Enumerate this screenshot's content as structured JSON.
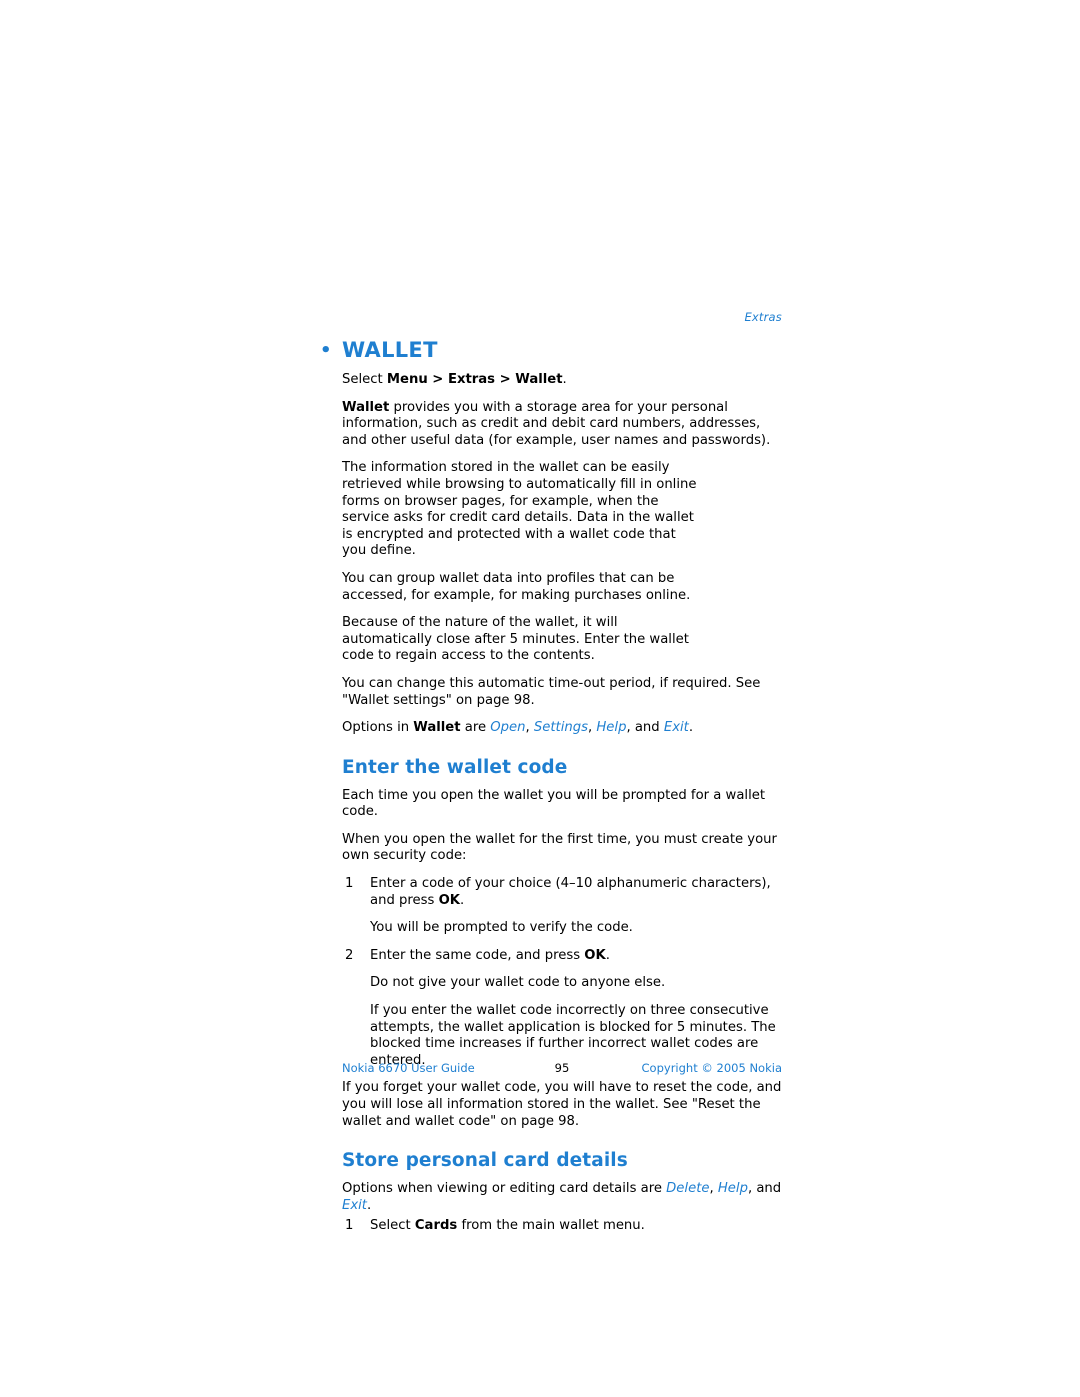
{
  "running_head": "Extras",
  "section": {
    "title": "WALLET",
    "select_path_prefix": "Select ",
    "select_path_bold": "Menu > Extras > Wallet",
    "select_path_suffix": ".",
    "para_wallet_lead_bold": "Wallet",
    "para_wallet_lead": " provides you with a storage area for your personal information, such as credit and debit card numbers, addresses, and other useful data (for example, user names and passwords).",
    "para_info_stored": "The information stored in the wallet can be easily retrieved while browsing to automatically fill in online forms on browser pages, for example, when the service asks for credit card details. Data in the wallet is encrypted and protected with a wallet code that you define.",
    "para_group": "You can group wallet data into profiles that can be accessed, for example, for making purchases online.",
    "para_nature": "Because of the nature of the wallet, it will automatically close after 5 minutes. Enter the wallet code to regain access to the contents.",
    "para_timeout": "You can change this automatic time-out period, if required. See \"Wallet settings\" on page 98.",
    "options_prefix": "Options in ",
    "options_bold": "Wallet",
    "options_mid": " are ",
    "options_items": [
      "Open",
      "Settings",
      "Help"
    ],
    "options_and": ", and ",
    "options_last": "Exit",
    "options_end": "."
  },
  "enter_code": {
    "title": "Enter the wallet code",
    "para_each_time": "Each time you open the wallet you will be prompted for a wallet code.",
    "para_first_time": "When you open the wallet for the first time, you must create your own security code:",
    "steps": [
      {
        "num": "1",
        "text_before": "Enter a code of your choice (4–10 alphanumeric characters), and press ",
        "bold": "OK",
        "text_after": ".",
        "sub": "You will be prompted to verify the code."
      },
      {
        "num": "2",
        "text_before": "Enter the same code, and press ",
        "bold": "OK",
        "text_after": ".",
        "sub": "Do not give your wallet code to anyone else."
      }
    ],
    "para_incorrect": "If you enter the wallet code incorrectly on three consecutive attempts, the wallet application is blocked for 5 minutes. The blocked time increases if further incorrect wallet codes are entered.",
    "para_forget": "If you forget your wallet code, you will have to reset the code, and you will lose all information stored in the wallet. See \"Reset the wallet and wallet code\" on page 98."
  },
  "store_card": {
    "title": "Store personal card details",
    "options_prefix": "Options when viewing or editing card details are ",
    "options_items": [
      "Delete",
      "Help"
    ],
    "options_and": ", and ",
    "options_last": "Exit",
    "options_end": ".",
    "step_num": "1",
    "step_before": "Select ",
    "step_bold": "Cards",
    "step_after": " from the main wallet menu."
  },
  "footer": {
    "left": "Nokia 6670 User Guide",
    "center": "95",
    "right": "Copyright © 2005 Nokia"
  }
}
